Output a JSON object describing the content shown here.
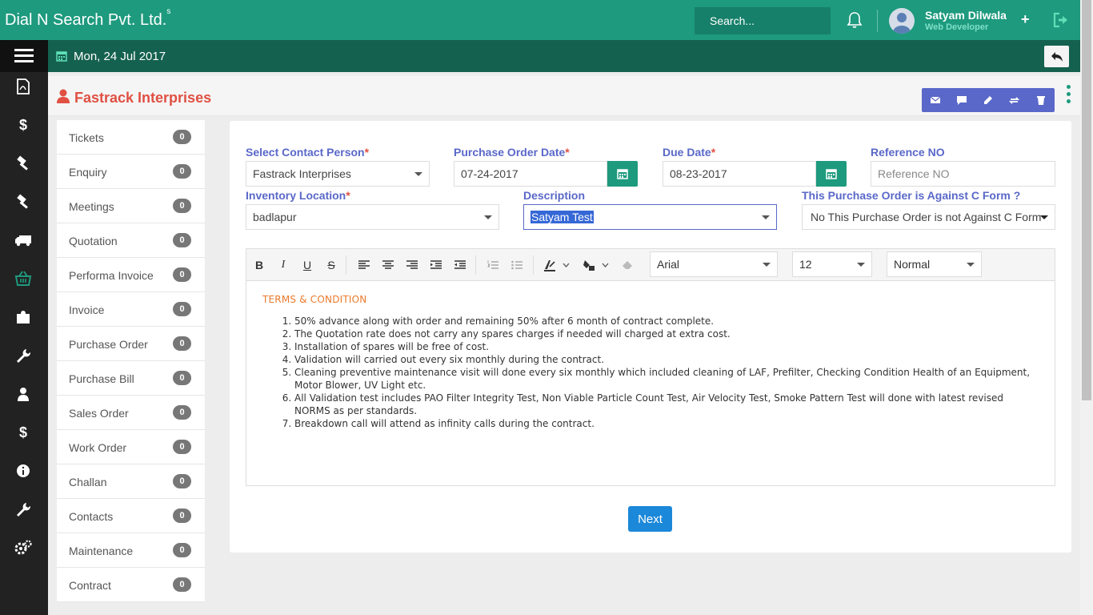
{
  "app": {
    "brand": "Dial N Search Pvt. Ltd.",
    "brand_sup": "s",
    "search_placeholder": "Search...",
    "user_name": "Satyam Dilwala",
    "user_role": "Web Developer",
    "plus": "+"
  },
  "subbar": {
    "date": "Mon, 24 Jul 2017"
  },
  "page": {
    "title": "Fastrack Interprises"
  },
  "sidebar": {
    "items": [
      {
        "label": "Tickets",
        "count": "0"
      },
      {
        "label": "Enquiry",
        "count": "0"
      },
      {
        "label": "Meetings",
        "count": "0"
      },
      {
        "label": "Quotation",
        "count": "0"
      },
      {
        "label": "Performa Invoice",
        "count": "0"
      },
      {
        "label": "Invoice",
        "count": "0"
      },
      {
        "label": "Purchase Order",
        "count": "0"
      },
      {
        "label": "Purchase Bill",
        "count": "0"
      },
      {
        "label": "Sales Order",
        "count": "0"
      },
      {
        "label": "Work Order",
        "count": "0"
      },
      {
        "label": "Challan",
        "count": "0"
      },
      {
        "label": "Contacts",
        "count": "0"
      },
      {
        "label": "Maintenance",
        "count": "0"
      },
      {
        "label": "Contract",
        "count": "0"
      }
    ]
  },
  "form": {
    "contact_label": "Select Contact Person",
    "contact_value": "Fastrack Interprises",
    "po_date_label": "Purchase Order Date",
    "po_date_value": "07-24-2017",
    "due_date_label": "Due Date",
    "due_date_value": "08-23-2017",
    "ref_label": "Reference NO",
    "ref_placeholder": "Reference NO",
    "inv_label": "Inventory Location",
    "inv_value": "badlapur",
    "desc_label": "Description",
    "desc_value": "Satyam Test",
    "cform_label": "This Purchase Order is Against C Form ?",
    "cform_value": "No This Purchase Order is not Against C Form",
    "required_mark": "*"
  },
  "editor": {
    "font_value": "Arial",
    "size_value": "12",
    "style_value": "Normal",
    "terms_heading": "TERMS & CONDITION",
    "items": [
      "50% advance along with order and remaining 50% after 6 month of contract complete.",
      "The Quotation rate does not carry any spares charges if needed will charged at extra cost.",
      "Installation of spares will be free of cost.",
      "Validation will carried out every six monthly during the contract.",
      "Cleaning preventive maintenance visit will done every six monthly which included cleaning of LAF, Prefilter, Checking Condition Health of an Equipment, Motor Blower, UV Light etc.",
      "All Validation test includes PAO Filter Integrity Test, Non Viable Particle Count Test, Air Velocity Test, Smoke Pattern Test will done with latest revised NORMS as per standards.",
      "Breakdown call will attend as infinity calls during the contract."
    ]
  },
  "next_label": "Next",
  "colors": {
    "primary": "#1e9a7e",
    "dark": "#15614f",
    "accent": "#5a68c9",
    "danger": "#e05043",
    "button": "#1c88d9"
  }
}
